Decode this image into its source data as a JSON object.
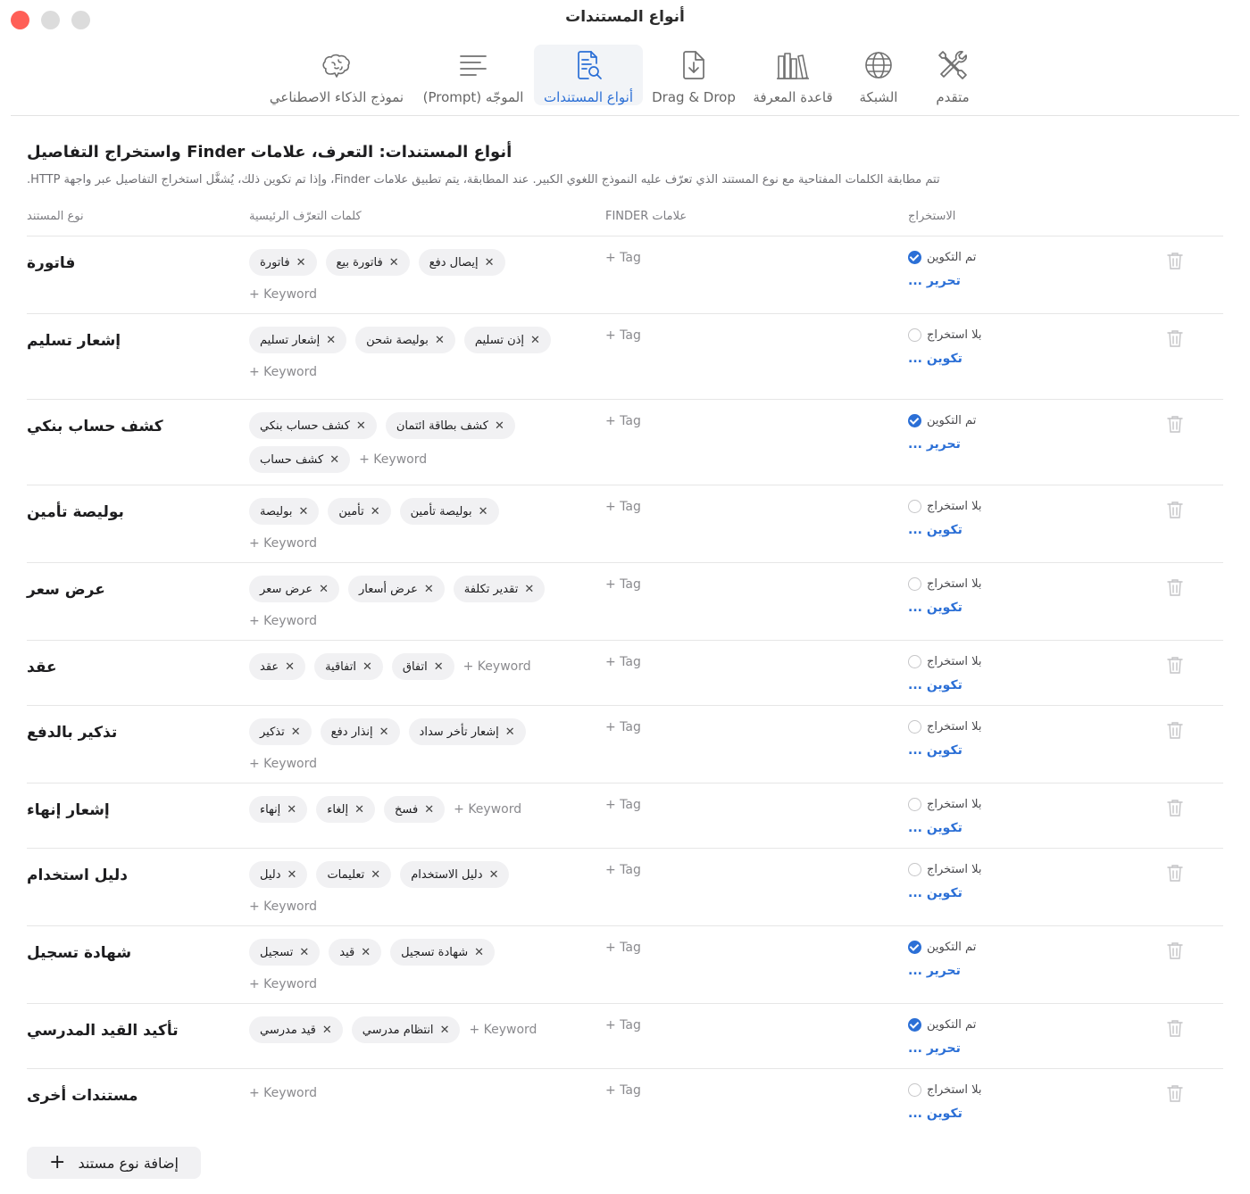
{
  "window": {
    "title": "أنواع المستندات"
  },
  "tabs": [
    {
      "id": "advanced",
      "label": "متقدم",
      "icon": "tools-icon"
    },
    {
      "id": "network",
      "label": "الشبكة",
      "icon": "globe-icon"
    },
    {
      "id": "kb",
      "label": "قاعدة المعرفة",
      "icon": "books-icon"
    },
    {
      "id": "dnd",
      "label": "Drag & Drop",
      "icon": "file-download-icon"
    },
    {
      "id": "doctypes",
      "label": "أنواع المستندات",
      "icon": "document-search-icon",
      "active": true
    },
    {
      "id": "prompt",
      "label": "الموجّه (Prompt)",
      "icon": "text-lines-icon"
    },
    {
      "id": "ai",
      "label": "نموذج الذكاء الاصطناعي",
      "icon": "brain-icon"
    }
  ],
  "section": {
    "title": "أنواع المستندات: التعرف، علامات Finder واستخراج التفاصيل",
    "description": "تتم مطابقة الكلمات المفتاحية مع نوع المستند الذي تعرّف عليه النموذج اللغوي الكبير. عند المطابقة، يتم تطبيق علامات Finder، وإذا تم تكوين ذلك، يُشغَّل استخراج التفاصيل عبر واجهة HTTP."
  },
  "columns": {
    "doc_type": "نوع المستند",
    "keywords": "كلمات التعرّف الرئيسية",
    "finder_tags": "علامات FINDER",
    "extraction": "الاستخراج"
  },
  "labels": {
    "add_keyword": "+ Keyword",
    "add_tag": "+ Tag",
    "configured": "تم التكوين",
    "not_extracted": "بلا استخراج",
    "edit": "تحرير ...",
    "configure": "تكوين ...",
    "add_doc_type": "إضافة نوع مستند"
  },
  "colors": {
    "accent": "#2b6fd6",
    "close": "#ff5f57"
  },
  "rows": [
    {
      "name": "فاتورة",
      "keywords": [
        "فاتورة",
        "فاتورة بيع",
        "إيصال دفع"
      ],
      "configured": true
    },
    {
      "name": "إشعار تسليم",
      "keywords": [
        "إشعار تسليم",
        "بوليصة شحن",
        "إذن تسليم"
      ],
      "configured": false
    },
    {
      "name": "كشف حساب بنكي",
      "keywords": [
        "كشف حساب بنكي",
        "كشف بطاقة ائتمان",
        "كشف حساب"
      ],
      "configured": true
    },
    {
      "name": "بوليصة تأمين",
      "keywords": [
        "بوليصة",
        "تأمين",
        "بوليصة تأمين"
      ],
      "configured": false
    },
    {
      "name": "عرض سعر",
      "keywords": [
        "عرض سعر",
        "عرض أسعار",
        "تقدير تكلفة"
      ],
      "configured": false
    },
    {
      "name": "عقد",
      "keywords": [
        "عقد",
        "اتفاقية",
        "اتفاق"
      ],
      "configured": false
    },
    {
      "name": "تذكير بالدفع",
      "keywords": [
        "تذكير",
        "إنذار دفع",
        "إشعار تأخر سداد"
      ],
      "configured": false
    },
    {
      "name": "إشعار إنهاء",
      "keywords": [
        "إنهاء",
        "إلغاء",
        "فسخ"
      ],
      "configured": false
    },
    {
      "name": "دليل استخدام",
      "keywords": [
        "دليل",
        "تعليمات",
        "دليل الاستخدام"
      ],
      "configured": false
    },
    {
      "name": "شهادة تسجيل",
      "keywords": [
        "تسجيل",
        "قيد",
        "شهادة تسجيل"
      ],
      "configured": true
    },
    {
      "name": "تأكيد القيد المدرسي",
      "keywords": [
        "قيد مدرسي",
        "انتظام مدرسي"
      ],
      "configured": true
    },
    {
      "name": "مستندات أخرى",
      "keywords": [],
      "configured": false
    }
  ]
}
